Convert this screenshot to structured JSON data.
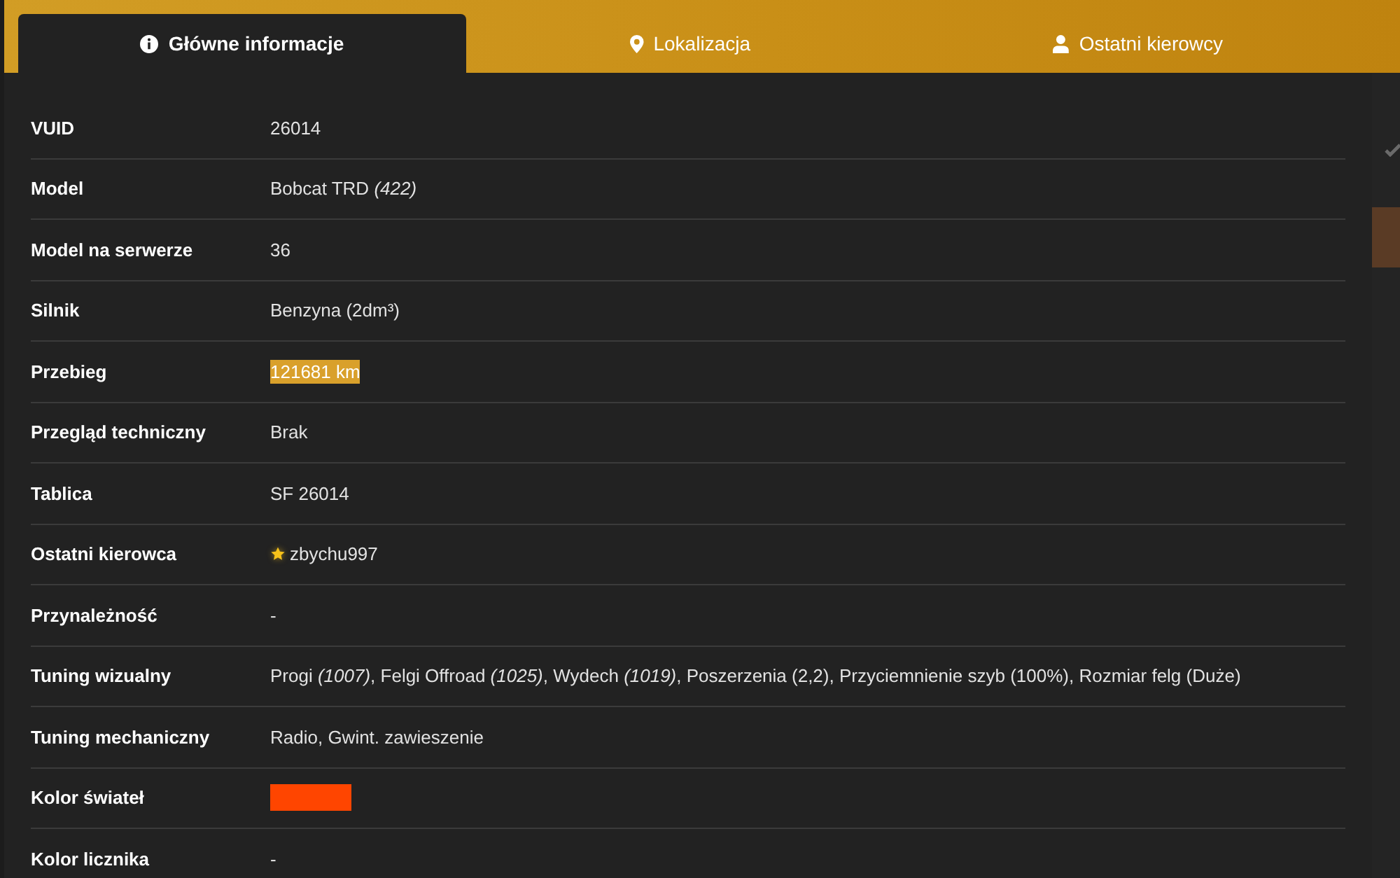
{
  "tabs": [
    {
      "label": "Główne informacje",
      "selected": true
    },
    {
      "label": "Lokalizacja",
      "selected": false
    },
    {
      "label": "Ostatni kierowcy",
      "selected": false
    }
  ],
  "rows": [
    {
      "label": "VUID",
      "kind": "text",
      "value": "26014",
      "highlighted": false
    },
    {
      "label": "Model",
      "kind": "text",
      "value": "Bobcat TRD *(422)*",
      "highlighted": false
    },
    {
      "label": "Model na serwerze",
      "kind": "text",
      "value": "36",
      "highlighted": false
    },
    {
      "label": "Silnik",
      "kind": "text",
      "value": "Benzyna (2dm³)",
      "highlighted": false
    },
    {
      "label": "Przebieg",
      "kind": "text",
      "value": "121681 km",
      "highlighted": true
    },
    {
      "label": "Przegląd techniczny",
      "kind": "text",
      "value": "Brak",
      "highlighted": false
    },
    {
      "label": "Tablica",
      "kind": "text",
      "value": "SF 26014",
      "highlighted": false
    },
    {
      "label": "Ostatni kierowca",
      "kind": "user",
      "value": "zbychu997",
      "highlighted": false
    },
    {
      "label": "Przynależność",
      "kind": "text",
      "value": "-",
      "highlighted": false
    },
    {
      "label": "Tuning wizualny",
      "kind": "text",
      "value": "Progi *(1007)*, Felgi Offroad *(1025)*, Wydech *(1019)*, Poszerzenia (2,2), Przyciemnienie szyb (100%), Rozmiar felg (Duże)",
      "highlighted": false
    },
    {
      "label": "Tuning mechaniczny",
      "kind": "text",
      "value": "Radio, Gwint. zawieszenie",
      "highlighted": false
    },
    {
      "label": "Kolor świateł",
      "kind": "color",
      "color": "#ff4500",
      "highlighted": false
    },
    {
      "label": "Kolor licznika",
      "kind": "text",
      "value": "-",
      "highlighted": false
    }
  ]
}
